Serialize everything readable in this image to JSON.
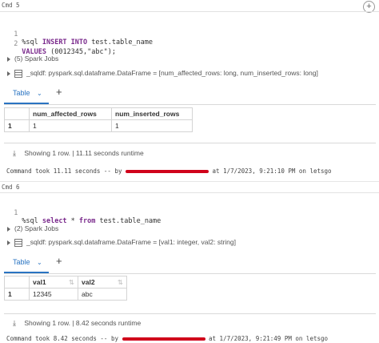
{
  "cells": [
    {
      "cmd_label": "Cmd 5",
      "code_lines": [
        {
          "num": "1",
          "parts": [
            [
              "",
              "%sql "
            ],
            [
              "kw",
              "INSERT INTO"
            ],
            [
              "",
              " test.table_name"
            ]
          ]
        },
        {
          "num": "2",
          "parts": [
            [
              "kw",
              "VALUES"
            ],
            [
              "",
              " (0012345,\"abc\");"
            ]
          ]
        }
      ],
      "spark_jobs": "(5) Spark Jobs",
      "schema": "_sqldf:  pyspark.sql.dataframe.DataFrame = [num_affected_rows: long, num_inserted_rows: long]",
      "tab_label": "Table",
      "headers": [
        "num_affected_rows",
        "num_inserted_rows"
      ],
      "rows": [
        [
          "1",
          "1",
          "1"
        ]
      ],
      "status": "Showing 1 row.  |  11.11 seconds runtime",
      "footer_prefix": "Command took 11.11 seconds -- by",
      "footer_suffix": "at 1/7/2023, 9:21:10 PM on letsgo"
    },
    {
      "cmd_label": "Cmd 6",
      "code_lines": [
        {
          "num": "1",
          "parts": [
            [
              "",
              "%sql "
            ],
            [
              "kw",
              "select"
            ],
            [
              "",
              " * "
            ],
            [
              "kw",
              "from"
            ],
            [
              "",
              " test.table_name"
            ]
          ]
        }
      ],
      "spark_jobs": "(2) Spark Jobs",
      "schema": "_sqldf:  pyspark.sql.dataframe.DataFrame = [val1: integer, val2: string]",
      "tab_label": "Table",
      "headers": [
        "val1",
        "val2"
      ],
      "rows": [
        [
          "1",
          "12345",
          "abc"
        ]
      ],
      "status": "Showing 1 row.  |  8.42 seconds runtime",
      "footer_prefix": "Command took 8.42 seconds -- by",
      "footer_suffix": "at 1/7/2023, 9:21:49 PM on letsgo"
    }
  ],
  "icons": {
    "add_cell": "plus-icon",
    "expand": "triangle-right-icon",
    "schema": "table-icon",
    "tab_dropdown": "chevron-down-icon",
    "add_tab": "plus-icon",
    "download": "download-icon",
    "sort": "sort-arrows-icon"
  },
  "colors": {
    "accent": "#2a74c2",
    "keyword": "#7a2a8c",
    "redaction": "#d0021b"
  }
}
